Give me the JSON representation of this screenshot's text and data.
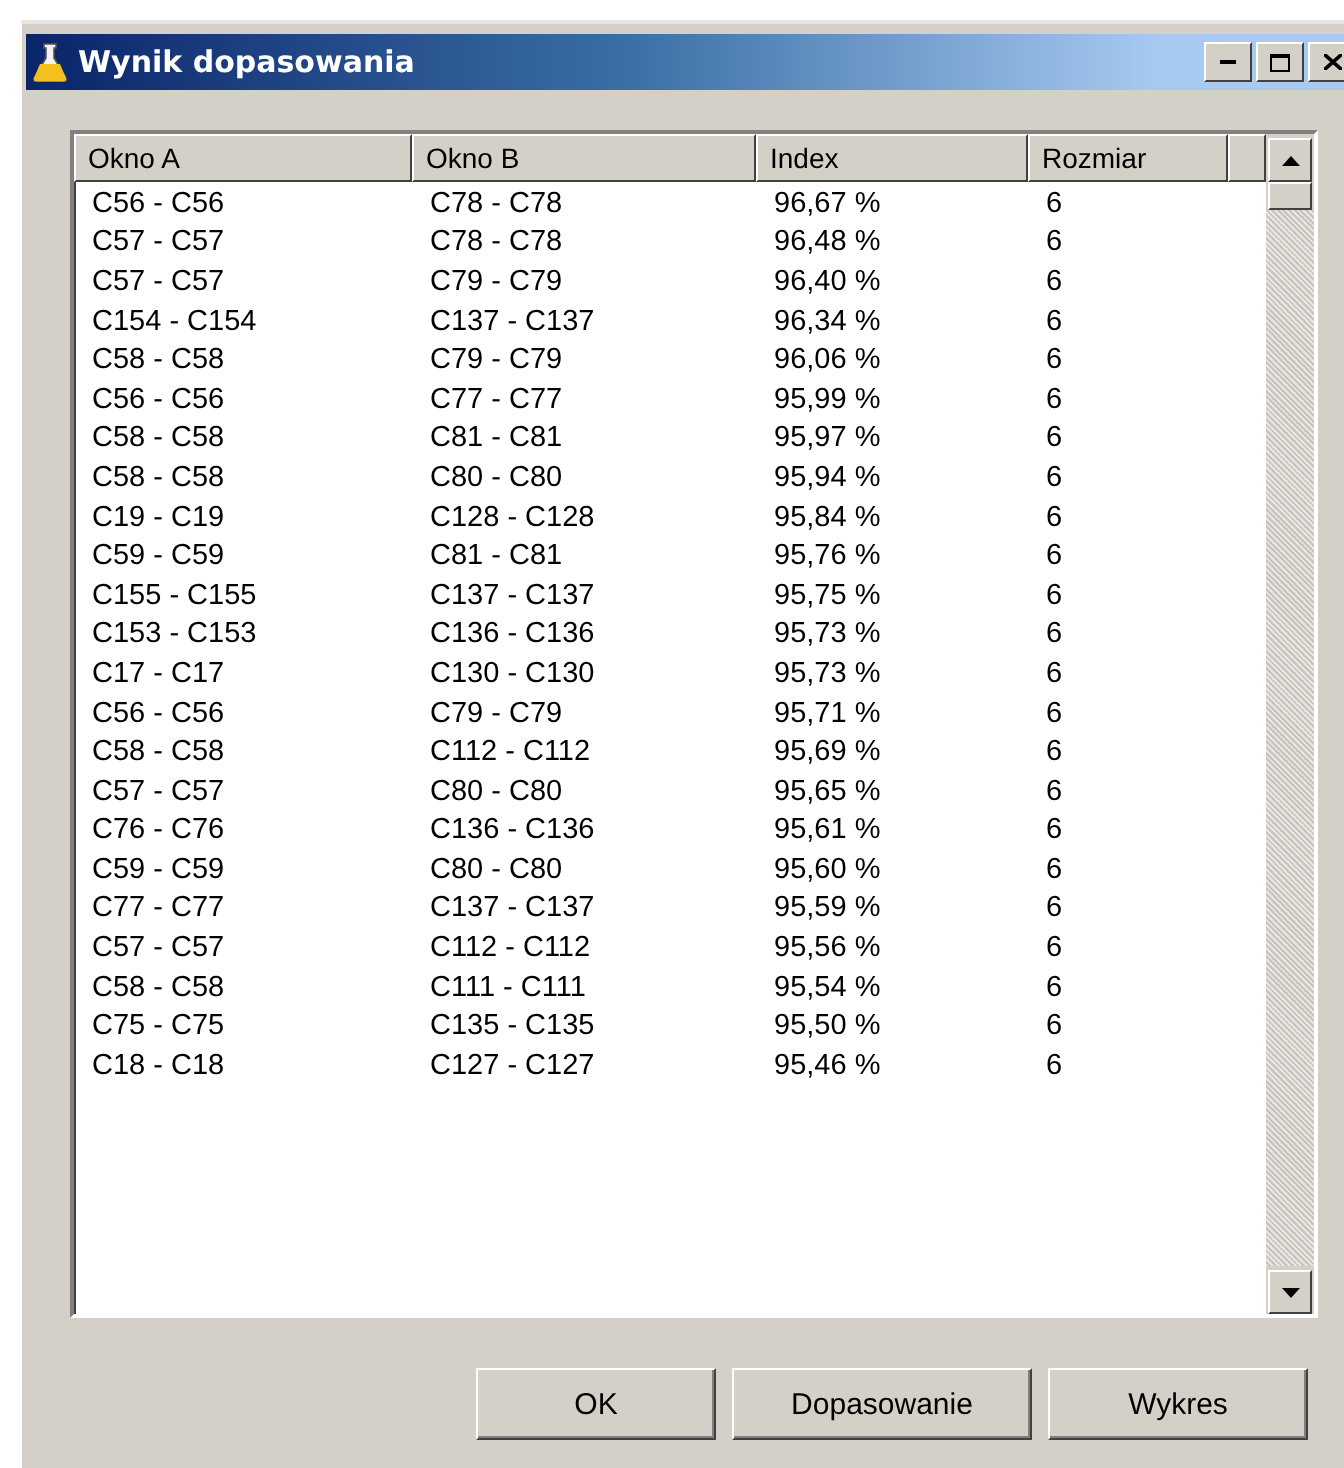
{
  "window": {
    "title": "Wynik dopasowania"
  },
  "table": {
    "columns": [
      "Okno A",
      "Okno B",
      "Index",
      "Rozmiar"
    ],
    "rows": [
      [
        "C56 - C56",
        "C78 - C78",
        "96,67 %",
        "6"
      ],
      [
        "C57 - C57",
        "C78 - C78",
        "96,48 %",
        "6"
      ],
      [
        "C57 - C57",
        "C79 - C79",
        "96,40 %",
        "6"
      ],
      [
        "C154 - C154",
        "C137 - C137",
        "96,34 %",
        "6"
      ],
      [
        "C58 - C58",
        "C79 - C79",
        "96,06 %",
        "6"
      ],
      [
        "C56 - C56",
        "C77 - C77",
        "95,99 %",
        "6"
      ],
      [
        "C58 - C58",
        "C81 - C81",
        "95,97 %",
        "6"
      ],
      [
        "C58 - C58",
        "C80 - C80",
        "95,94 %",
        "6"
      ],
      [
        "C19 - C19",
        "C128 - C128",
        "95,84 %",
        "6"
      ],
      [
        "C59 - C59",
        "C81 - C81",
        "95,76 %",
        "6"
      ],
      [
        "C155 - C155",
        "C137 - C137",
        "95,75 %",
        "6"
      ],
      [
        "C153 - C153",
        "C136 - C136",
        "95,73 %",
        "6"
      ],
      [
        "C17 - C17",
        "C130 - C130",
        "95,73 %",
        "6"
      ],
      [
        "C56 - C56",
        "C79 - C79",
        "95,71 %",
        "6"
      ],
      [
        "C58 - C58",
        "C112 - C112",
        "95,69 %",
        "6"
      ],
      [
        "C57 - C57",
        "C80 - C80",
        "95,65 %",
        "6"
      ],
      [
        "C76 - C76",
        "C136 - C136",
        "95,61 %",
        "6"
      ],
      [
        "C59 - C59",
        "C80 - C80",
        "95,60 %",
        "6"
      ],
      [
        "C77 - C77",
        "C137 - C137",
        "95,59 %",
        "6"
      ],
      [
        "C57 - C57",
        "C112 - C112",
        "95,56 %",
        "6"
      ],
      [
        "C58 - C58",
        "C111 - C111",
        "95,54 %",
        "6"
      ],
      [
        "C75 - C75",
        "C135 - C135",
        "95,50 %",
        "6"
      ],
      [
        "C18 - C18",
        "C127 - C127",
        "95,46 %",
        "6"
      ]
    ]
  },
  "buttons": [
    "OK",
    "Dopasowanie",
    "Wykres"
  ]
}
